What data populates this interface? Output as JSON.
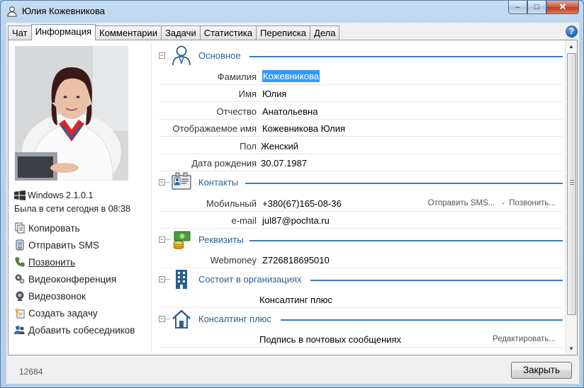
{
  "window": {
    "title": "Юлия Кожевникова",
    "minimize": "–",
    "maximize": "□",
    "close": "✕"
  },
  "tabs": [
    {
      "label": "Чат",
      "active": false
    },
    {
      "label": "Информация",
      "active": true
    },
    {
      "label": "Комментарии",
      "active": false
    },
    {
      "label": "Задачи",
      "active": false
    },
    {
      "label": "Статистика",
      "active": false
    },
    {
      "label": "Переписка",
      "active": false
    },
    {
      "label": "Дела",
      "active": false
    }
  ],
  "help_label": "?",
  "profile": {
    "os": "Windows 2.1.0.1",
    "online": "Была в сети сегодня в 08:38"
  },
  "actions": [
    {
      "label": "Копировать",
      "icon": "copy-icon"
    },
    {
      "label": "Отправить SMS",
      "icon": "sms-icon"
    },
    {
      "label": "Позвонить",
      "icon": "phone-icon"
    },
    {
      "label": "Видеоконференция",
      "icon": "videoconference-icon"
    },
    {
      "label": "Видеозвонок",
      "icon": "webcam-icon"
    },
    {
      "label": "Создать задачу",
      "icon": "task-icon"
    },
    {
      "label": "Добавить собеседников",
      "icon": "add-people-icon"
    }
  ],
  "sections": {
    "basic": {
      "title": "Основное",
      "fields": [
        {
          "label": "Фамилия",
          "value": "Кожевникова"
        },
        {
          "label": "Имя",
          "value": "Юлия"
        },
        {
          "label": "Отчество",
          "value": "Анатольевна"
        },
        {
          "label": "Отображаемое имя",
          "value": "Кожевникова Юлия"
        },
        {
          "label": "Пол",
          "value": "Женский"
        },
        {
          "label": "Дата рождения",
          "value": "30.07.1987"
        }
      ]
    },
    "contacts": {
      "title": "Контакты",
      "mobile_label": "Мобильный",
      "mobile_value": "+380(67)165-08-36",
      "send_sms": "Отправить SMS...",
      "separator": "-",
      "call": "Позвонить...",
      "email_label": "e-mail",
      "email_value": "jul87@pochta.ru"
    },
    "requisites": {
      "title": "Реквизиты",
      "label": "Webmoney",
      "value": "Z726818695010"
    },
    "orgs": {
      "title": "Состоит в организациях",
      "value": "Консалтинг плюс"
    },
    "company": {
      "title": "Консалтинг плюс",
      "value": "Подпись в почтовых сообщениях",
      "edit": "Редактировать..."
    }
  },
  "footer": {
    "id": "12684",
    "close_button": "Закрыть"
  },
  "colors": {
    "section_title": "#2a5f91",
    "section_line": "#3d7cb7",
    "selection": "#3399ff"
  }
}
